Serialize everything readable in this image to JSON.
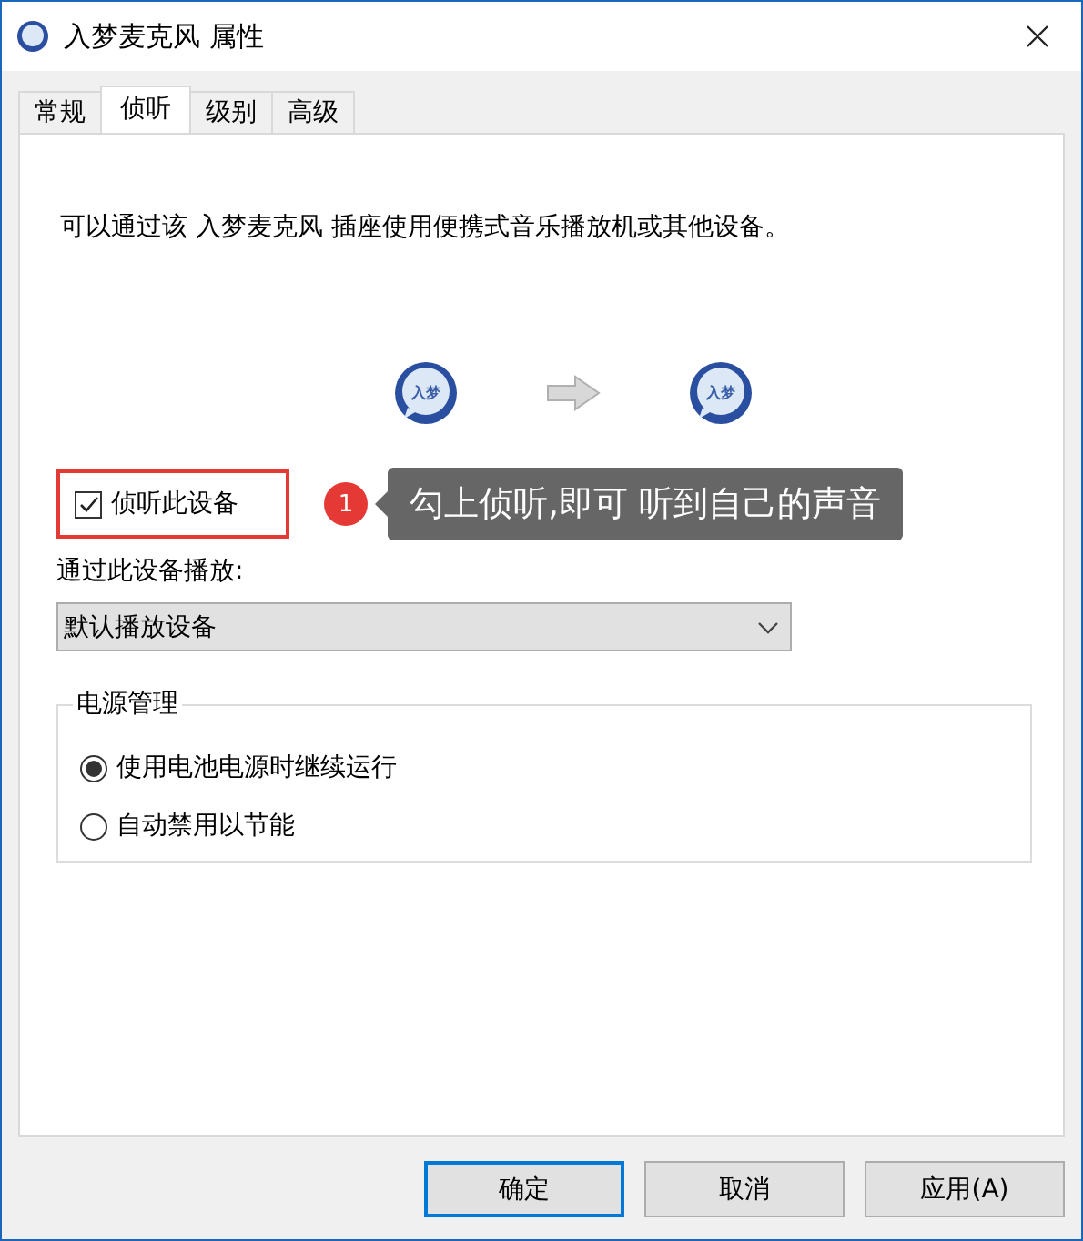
{
  "window": {
    "title": "入梦麦克风 属性"
  },
  "tabs": [
    {
      "label": "常规",
      "selected": false
    },
    {
      "label": "侦听",
      "selected": true
    },
    {
      "label": "级别",
      "selected": false
    },
    {
      "label": "高级",
      "selected": false
    }
  ],
  "description": "可以通过该 入梦麦克风 插座使用便携式音乐播放机或其他设备。",
  "monitor_flow": {
    "source_label": "入梦",
    "target_label": "入梦"
  },
  "listen_checkbox": {
    "label": "侦听此设备",
    "checked": true
  },
  "annotation": {
    "number": "1",
    "callout": "勾上侦听,即可 听到自己的声音"
  },
  "playback": {
    "label": "通过此设备播放:",
    "value": "默认播放设备"
  },
  "power_management": {
    "legend": "电源管理",
    "options": [
      {
        "label": "使用电池电源时继续运行",
        "selected": true
      },
      {
        "label": "自动禁用以节能",
        "selected": false
      }
    ]
  },
  "buttons": [
    {
      "label": "确定",
      "default": true
    },
    {
      "label": "取消",
      "default": false
    },
    {
      "label": "应用(A)",
      "default": false
    }
  ]
}
